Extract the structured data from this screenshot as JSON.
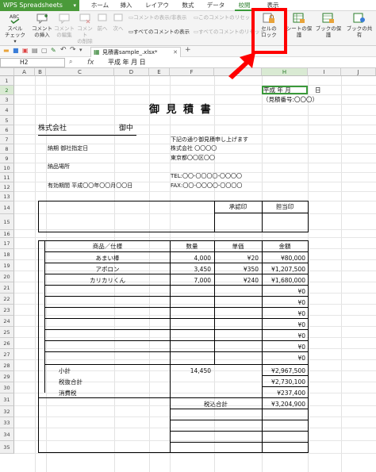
{
  "app": {
    "name": "WPS Spreadsheets"
  },
  "menu": {
    "tabs": [
      "ホーム",
      "挿入",
      "レイアウト",
      "数式",
      "データ",
      "校閲",
      "表示"
    ],
    "active": "校閲"
  },
  "ribbon": {
    "spell_top": "スペル",
    "spell_bot": "チェック ▾",
    "insert_comment_top": "コメント",
    "insert_comment_bot": "の挿入",
    "edit_comment_top": "コメント",
    "edit_comment_bot": "の編集",
    "delete_comment_top": "コメント",
    "delete_comment_bot": "の削除",
    "prev": "前へ",
    "next": "次へ",
    "show_hide_comment": "コメントの表示/非表示",
    "reset_comment": "このコメントのリセット",
    "show_all_comments": "すべてのコメントの表示",
    "reset_all_comments": "すべてのコメントのリセット",
    "lock_cell_top": "セルの",
    "lock_cell_bot": "ロック",
    "protect_sheet": "シートの保護",
    "protect_book": "ブックの保護",
    "share_book": "ブックの共有"
  },
  "document": {
    "tab_name": "見積書sample_.xlsx*",
    "add_tab": "+"
  },
  "formula_bar": {
    "cell_ref": "H2",
    "fx": "fx",
    "value": "平成  年    月    日"
  },
  "columns": [
    "A",
    "B",
    "C",
    "D",
    "E",
    "F",
    "G",
    "H",
    "I",
    "J"
  ],
  "selected_column": "H",
  "rows": [
    "1",
    "2",
    "3",
    "4",
    "5",
    "6",
    "7",
    "8",
    "9",
    "10",
    "11",
    "12",
    "13",
    "14",
    "15",
    "16",
    "17",
    "18",
    "19",
    "20",
    "21",
    "22",
    "23",
    "24",
    "25",
    "26",
    "27",
    "28",
    "29",
    "30",
    "31",
    "32",
    "33",
    "34",
    "35"
  ],
  "selected_row": "2",
  "sheet": {
    "date": "平成  年    月",
    "date_day": "日",
    "estimate_no": "（見積番号:〇〇〇）",
    "title": "御 見 積 書",
    "company": "株式会社",
    "onchu": "御中",
    "intro": "下記の通り御見積申し上げます",
    "delivery": "納期    御社指定日",
    "seller": "株式会社  〇〇〇〇",
    "seller_addr": "東京都〇〇区〇〇",
    "place": "納品場所",
    "tel": "TEL:〇〇-〇〇〇〇-〇〇〇〇",
    "valid": "有効期間    平成〇〇年〇〇月〇〇日",
    "fax": "FAX:〇〇-〇〇〇〇-〇〇〇〇",
    "approve": "承認印",
    "person": "担当印",
    "hdr_item": "商品／仕様",
    "hdr_qty": "数量",
    "hdr_price": "単価",
    "hdr_amount": "金額",
    "items": [
      {
        "name": "あまい棒",
        "qty": "4,000",
        "price": "¥20",
        "amount": "¥80,000"
      },
      {
        "name": "アポロン",
        "qty": "3,450",
        "price": "¥350",
        "amount": "¥1,207,500"
      },
      {
        "name": "カリカリくん",
        "qty": "7,000",
        "price": "¥240",
        "amount": "¥1,680,000"
      }
    ],
    "zero": "¥0",
    "subtotal_label": "小計",
    "subtotal_qty": "14,450",
    "subtotal_amount": "¥2,967,500",
    "pretax_label": "税抜合計",
    "pretax_amount": "¥2,730,100",
    "tax_label": "消費税",
    "tax_amount": "¥237,400",
    "total_label": "税込合計",
    "total_amount": "¥3,204,900"
  },
  "colors": {
    "wps_green": "#4a9a3a",
    "highlight": "#ff0000",
    "select": "#3a9a3a"
  }
}
